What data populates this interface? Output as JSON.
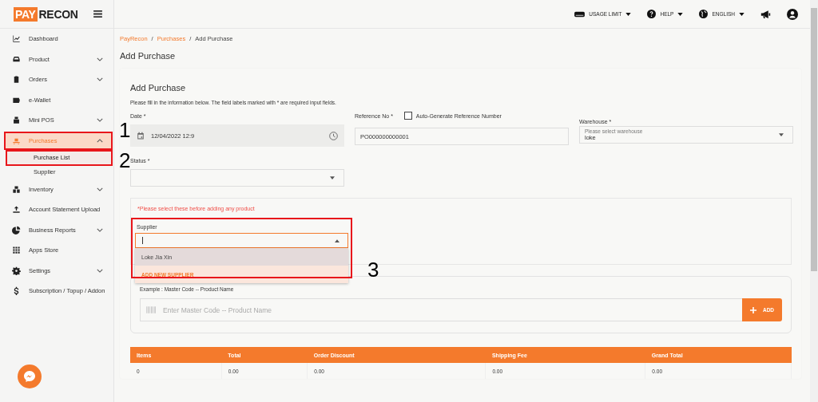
{
  "logo": {
    "part_1": "PAY",
    "part_2": "RECON"
  },
  "topbar": {
    "items": [
      {
        "label": "USAGE LIMIT",
        "kind": "dropdown"
      },
      {
        "label": "HELP",
        "kind": "dropdown"
      },
      {
        "label": "ENGLISH",
        "kind": "dropdown"
      }
    ]
  },
  "sidebar": {
    "items": [
      {
        "label": "Dashboard",
        "kind": "link",
        "selected": false
      },
      {
        "label": "Product",
        "kind": "group",
        "expanded": false,
        "selected": false
      },
      {
        "label": "Orders",
        "kind": "group",
        "expanded": false,
        "selected": false
      },
      {
        "label": "e-Wallet",
        "kind": "link",
        "selected": false
      },
      {
        "label": "Mini POS",
        "kind": "group",
        "expanded": false,
        "selected": false
      },
      {
        "label": "Purchases",
        "kind": "group",
        "expanded": true,
        "selected": true,
        "outlined": true,
        "children": [
          {
            "label": "Purchase List",
            "selected": true,
            "outlined": true
          },
          {
            "label": "Supplier",
            "selected": false,
            "outlined": false
          }
        ]
      },
      {
        "label": "Inventory",
        "kind": "group",
        "expanded": false,
        "selected": false
      },
      {
        "label": "Account Statement Upload",
        "kind": "link",
        "selected": false
      },
      {
        "label": "Business Reports",
        "kind": "group",
        "expanded": false,
        "selected": false
      },
      {
        "label": "Apps Store",
        "kind": "link",
        "selected": false
      },
      {
        "label": "Settings",
        "kind": "group",
        "expanded": false,
        "selected": false
      },
      {
        "label": "Subscription / Topup / Addon",
        "kind": "link",
        "selected": false
      }
    ]
  },
  "breadcrumb": {
    "separator": "/",
    "items": [
      {
        "label": "PayRecon",
        "kind": "link"
      },
      {
        "label": "Purchases",
        "kind": "link"
      },
      {
        "label": "Add Purchase",
        "kind": "current"
      }
    ]
  },
  "page_title": "Add Purchase",
  "form": {
    "title": "Add Purchase",
    "description": "Please fill in the information below. The field labels marked with * are required input fields.",
    "date": {
      "label": "Date *",
      "value": "12/04/2022 12:9"
    },
    "reference": {
      "label": "Reference No *",
      "checkbox_label": "Auto-Generate Reference Number",
      "checked": false,
      "value": "PO000000000001"
    },
    "warehouse": {
      "label": "Warehouse *",
      "placeholder": "Please select warehouse",
      "value": "loke"
    },
    "status": {
      "label": "Status *"
    }
  },
  "supplier_section": {
    "warning": "*Please select these before adding any product",
    "label": "Supplier",
    "expanded": true,
    "outlined": true,
    "options": [
      {
        "label": "Loke Jia Xin",
        "kind": "option",
        "selected": true
      },
      {
        "label": "ADD NEW SUPPLIER",
        "kind": "action",
        "selected": false
      }
    ]
  },
  "product_search": {
    "example": "Example : Master Code -- Product Name",
    "placeholder": "Enter Master Code -- Product Name",
    "button": "ADD"
  },
  "table": {
    "columns": [
      "Items",
      "Total",
      "Order Discount",
      "Shipping Fee",
      "Grand Total"
    ],
    "rows": [
      [
        "0",
        "0.00",
        "0.00",
        "0.00",
        "0.00"
      ]
    ]
  },
  "annotations": [
    {
      "label": "1"
    },
    {
      "label": "2"
    },
    {
      "label": "3"
    }
  ]
}
